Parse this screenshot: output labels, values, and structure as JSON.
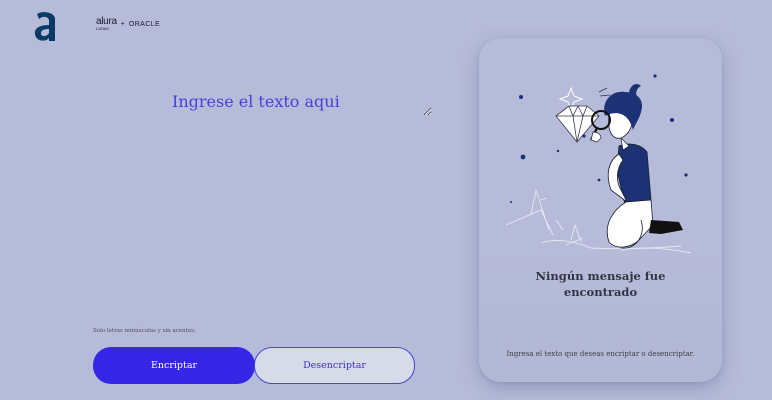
{
  "brand": {
    "logo_icon": "alura-a-logo",
    "alura": "alura",
    "alura_sub": "LATAM",
    "plus": "+",
    "oracle": "ORACLE",
    "accent": "#3626e6",
    "logo_color": "#0b3a66"
  },
  "input": {
    "placeholder": "Ingrese el texto aqui",
    "value": ""
  },
  "hint": "Solo letras minúsculas y sin acentos.",
  "buttons": {
    "encrypt": "Encriptar",
    "decrypt": "Desencriptar"
  },
  "output": {
    "illustration_icon": "person-magnifier-diamond-illustration",
    "title": "Ningún mensaje fue encontrado",
    "subtitle": "Ingresa el texto que deseas encriptar o desencriptar."
  }
}
